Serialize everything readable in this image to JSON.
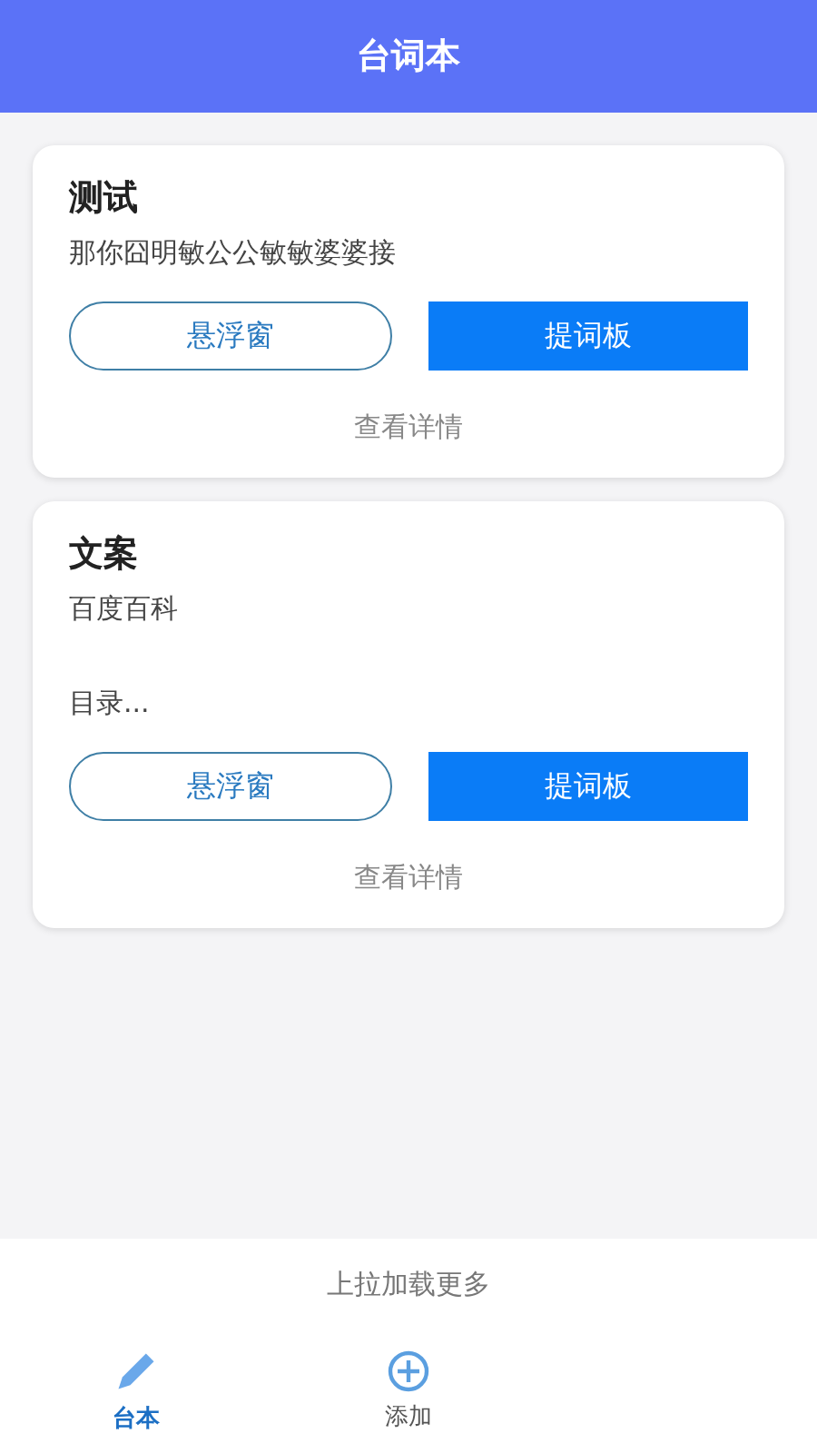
{
  "header": {
    "title": "台词本"
  },
  "cards": [
    {
      "title": "测试",
      "lines": [
        {
          "text": "那你囧明敏公公敏敏婆婆接"
        }
      ],
      "buttons": [
        {
          "label": "悬浮窗",
          "kind": "outline"
        },
        {
          "label": "提词板",
          "kind": "solid"
        }
      ],
      "link": "查看详情"
    },
    {
      "title": "文案",
      "lines": [
        {
          "text": "百度百科"
        },
        {
          "text": "目录..."
        }
      ],
      "buttons": [
        {
          "label": "悬浮窗",
          "kind": "outline"
        },
        {
          "label": "提词板",
          "kind": "solid"
        }
      ],
      "link": "查看详情"
    }
  ],
  "load_more": "上拉加载更多",
  "tabs": [
    {
      "label": "台本",
      "kind": "pencil",
      "selected": true
    },
    {
      "label": "添加",
      "kind": "add",
      "selected": false
    }
  ]
}
